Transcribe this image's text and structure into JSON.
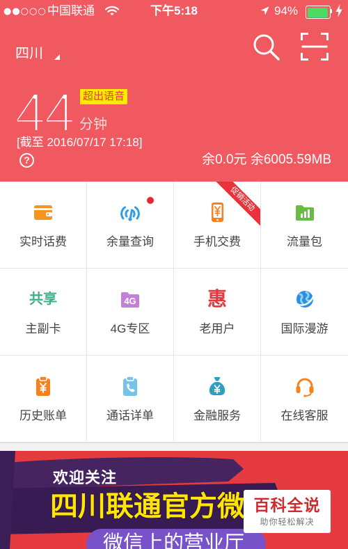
{
  "colors": {
    "header_bg": "#f0595f",
    "badge_bg": "#ffea00",
    "badge_text": "#e53a3f",
    "grid_border": "#e6e6e6",
    "label_text": "#444444",
    "banner_bg": "#e53b40",
    "ribbon": "#e8333a",
    "battery_fill": "#4cd964"
  },
  "status_bar": {
    "signal": "●●○○○",
    "carrier": "中国联通",
    "time": "下午5:18",
    "battery_text": "94%",
    "battery_level": 0.94,
    "icons": [
      "wifi-icon",
      "location-icon",
      "battery-icon",
      "charging-icon"
    ]
  },
  "header": {
    "region": "四川",
    "usage_value": "44",
    "usage_unit": "分钟",
    "badge": "超出语音",
    "as_of": "[截至 2016/07/17 17:18]",
    "help_glyph": "?",
    "balance": "余0.0元",
    "data_remaining": "余6005.59MB",
    "icons": [
      "dropdown-icon",
      "search-icon",
      "scan-icon",
      "help-icon"
    ]
  },
  "grid": [
    {
      "label": "实时话费",
      "icon": "wallet-icon"
    },
    {
      "label": "余量查询",
      "icon": "gauge-icon",
      "has_notification_dot": true
    },
    {
      "label": "手机交费",
      "icon": "phone-payment-icon",
      "ribbon": "促销活动"
    },
    {
      "label": "流量包",
      "icon": "data-folder-icon"
    },
    {
      "label": "主副卡",
      "icon": "share-icon",
      "icon_text": "共享"
    },
    {
      "label": "4G专区",
      "icon": "4g-folder-icon",
      "icon_text": "4G"
    },
    {
      "label": "老用户",
      "icon": "hui-icon",
      "icon_text": "惠"
    },
    {
      "label": "国际漫游",
      "icon": "globe-icon"
    },
    {
      "label": "历史账单",
      "icon": "bill-icon"
    },
    {
      "label": "通话详单",
      "icon": "call-detail-icon"
    },
    {
      "label": "金融服务",
      "icon": "money-bag-icon"
    },
    {
      "label": "在线客服",
      "icon": "headset-icon"
    }
  ],
  "banner": {
    "line1": "欢迎关注",
    "line2": "四川联通官方微",
    "line3": "微信上的营业厅"
  },
  "watermark": {
    "title": "百科全说",
    "subtitle": "助你轻松解决"
  }
}
